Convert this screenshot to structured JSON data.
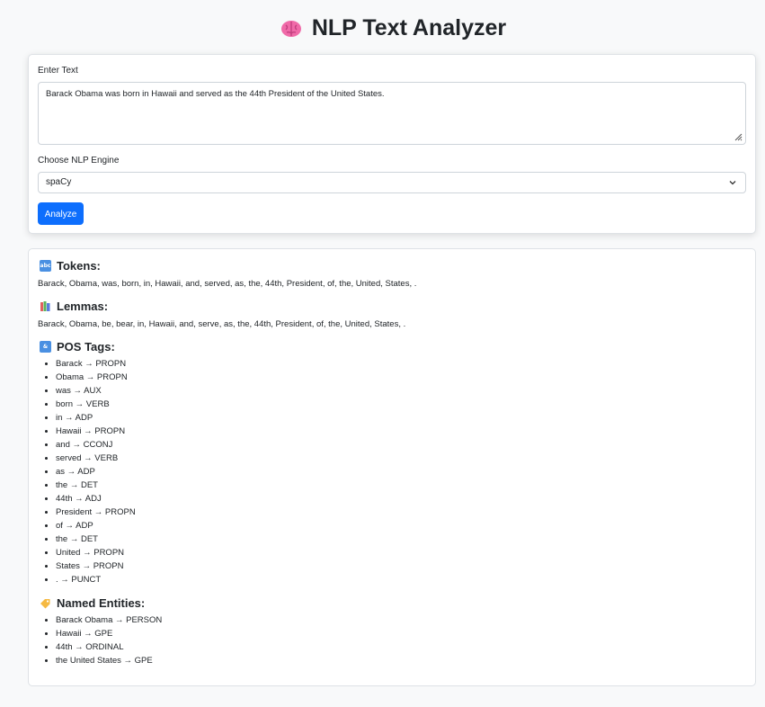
{
  "app": {
    "title": "NLP Text Analyzer",
    "title_icon": "brain-icon"
  },
  "form": {
    "text_label": "Enter Text",
    "text_value": "Barack Obama was born in Hawaii and served as the 44th President of the United States.",
    "engine_label": "Choose NLP Engine",
    "engine_value": "spaCy",
    "analyze_label": "Analyze",
    "accent_color": "#0d6efd"
  },
  "results": {
    "tokens": {
      "icon": "abc-icon",
      "heading": "Tokens:",
      "text": "Barack, Obama, was, born, in, Hawaii, and, served, as, the, 44th, President, of, the, United, States, ."
    },
    "lemmas": {
      "icon": "books-icon",
      "heading": "Lemmas:",
      "text": "Barack, Obama, be, bear, in, Hawaii, and, serve, as, the, 44th, President, of, the, United, States, ."
    },
    "pos": {
      "icon": "symbols-icon",
      "heading": "POS Tags:",
      "items": [
        "Barack → PROPN",
        "Obama → PROPN",
        "was → AUX",
        "born → VERB",
        "in → ADP",
        "Hawaii → PROPN",
        "and → CCONJ",
        "served → VERB",
        "as → ADP",
        "the → DET",
        "44th → ADJ",
        "President → PROPN",
        "of → ADP",
        "the → DET",
        "United → PROPN",
        "States → PROPN",
        ". → PUNCT"
      ]
    },
    "entities": {
      "icon": "tag-icon",
      "heading": "Named Entities:",
      "items": [
        "Barack Obama → PERSON",
        "Hawaii → GPE",
        "44th → ORDINAL",
        "the United States → GPE"
      ]
    }
  }
}
